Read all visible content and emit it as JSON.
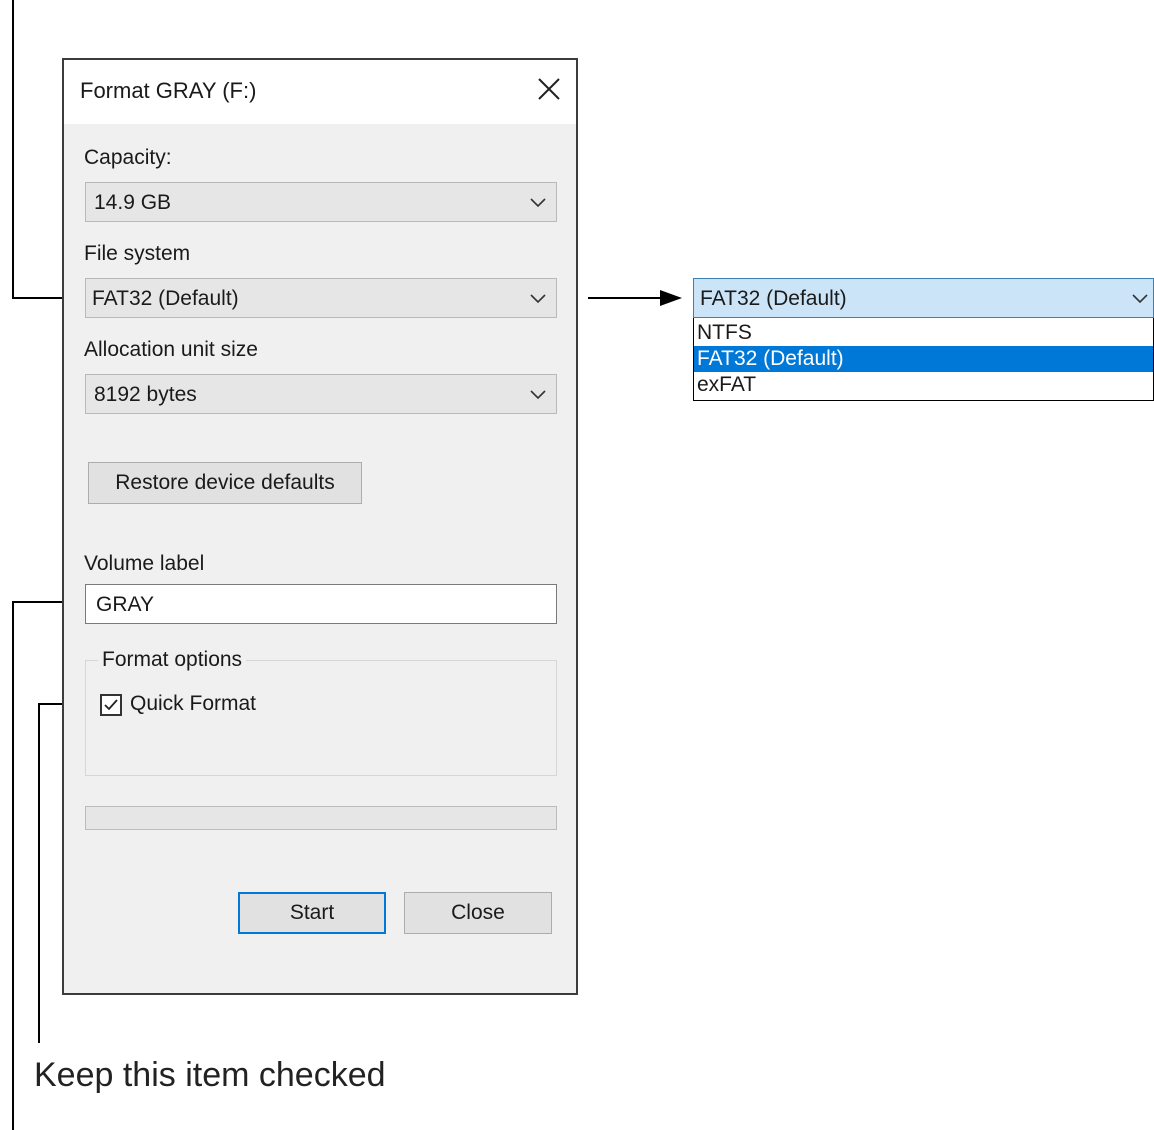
{
  "dialog": {
    "title": "Format GRAY (F:)",
    "capacity": {
      "label": "Capacity:",
      "value": "14.9 GB"
    },
    "file_system": {
      "label": "File system",
      "value": "FAT32 (Default)"
    },
    "allocation": {
      "label": "Allocation unit size",
      "value": "8192 bytes"
    },
    "restore_label": "Restore device defaults",
    "volume": {
      "label": "Volume label",
      "value": "GRAY"
    },
    "format_options": {
      "legend": "Format options",
      "quick_format_label": "Quick Format",
      "quick_format_checked": true
    },
    "progress_value": 0,
    "start_label": "Start",
    "close_label": "Close"
  },
  "dropdown": {
    "value": "FAT32 (Default)",
    "options": [
      {
        "label": "NTFS",
        "selected": false
      },
      {
        "label": "FAT32 (Default)",
        "selected": true
      },
      {
        "label": "exFAT",
        "selected": false
      }
    ]
  },
  "annotation": {
    "text": "Keep this item checked"
  },
  "colors": {
    "accent": "#0078d7",
    "primary_border": "#0078d7"
  },
  "icons": {
    "close": "close-icon",
    "chevron": "chevron-down-icon",
    "check": "checkmark-icon",
    "arrow": "arrow-right-icon"
  }
}
